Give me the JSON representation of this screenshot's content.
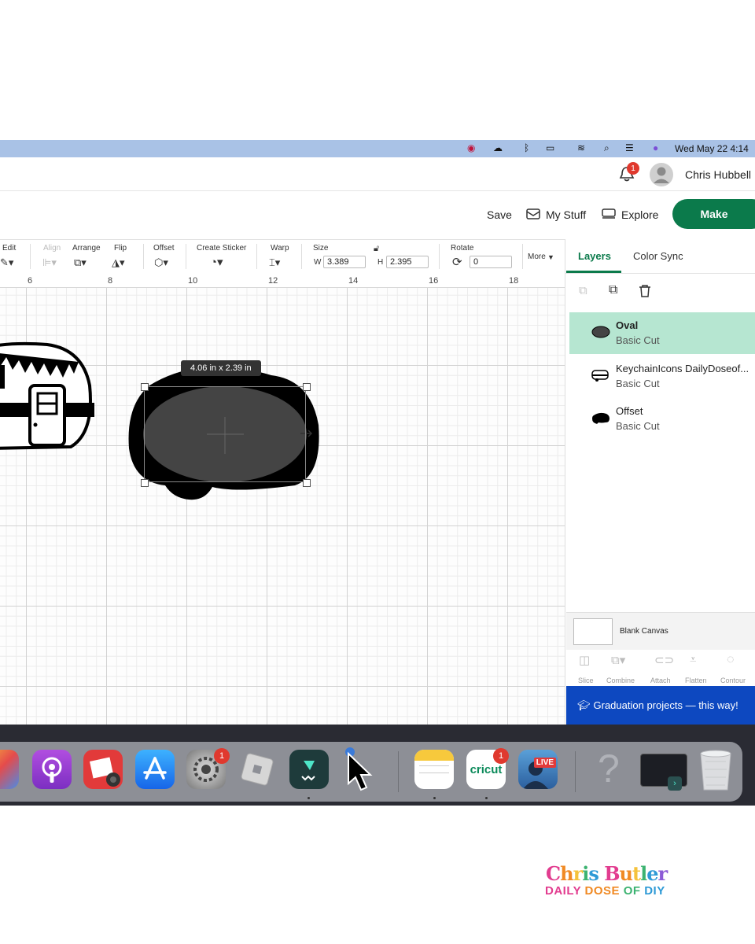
{
  "system_menubar": {
    "clock": "Wed May 22  4:14"
  },
  "header": {
    "notifications_badge": "1",
    "user_name": "Chris Hubbell",
    "save_label": "Save",
    "mystuff_label": "My Stuff",
    "explore_label": "Explore",
    "make_label": "Make"
  },
  "toolbar": {
    "edit": "Edit",
    "align": "Align",
    "arrange": "Arrange",
    "flip": "Flip",
    "offset": "Offset",
    "create_sticker": "Create Sticker",
    "warp": "Warp",
    "size": "Size",
    "w_label": "W",
    "w_value": "3.389",
    "h_label": "H",
    "h_value": "2.395",
    "rotate": "Rotate",
    "rotate_value": "0",
    "more": "More"
  },
  "ruler": [
    "6",
    "8",
    "10",
    "12",
    "14",
    "16",
    "18"
  ],
  "canvas": {
    "dimension_tooltip": "4.06  in x 2.39  in"
  },
  "panel": {
    "tabs": [
      "Layers",
      "Color Sync"
    ],
    "layers": [
      {
        "name": "Oval",
        "type": "Basic Cut",
        "selected": true
      },
      {
        "name": "KeychainIcons DailyDoseof...",
        "type": "Basic Cut",
        "selected": false
      },
      {
        "name": "Offset",
        "type": "Basic Cut",
        "selected": false
      }
    ],
    "blank_canvas": "Blank Canvas",
    "bottom_tools": [
      "Slice",
      "Combine",
      "Attach",
      "Flatten",
      "Contour"
    ],
    "promo": "Graduation projects — this way!"
  },
  "dock": {
    "settings_badge": "1",
    "cricut_badge": "1",
    "cricut_label": "cricut",
    "live_label": "LIVE"
  },
  "watermark": {
    "line1": "Chris Butler",
    "line2": "DAILY DOSE OF DIY"
  },
  "colors": {
    "accent_green": "#0b7a4b",
    "selected_layer": "#b6e6d1",
    "promo_blue": "#0d48c0"
  }
}
